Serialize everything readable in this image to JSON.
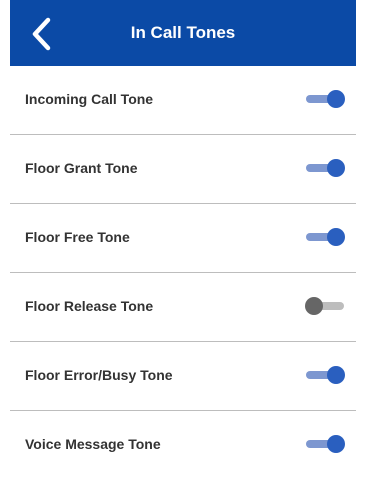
{
  "colors": {
    "header_bg": "#0b4aa6",
    "toggle_on_thumb": "#2a5fbf",
    "toggle_on_track": "#7d97d0",
    "toggle_off_thumb": "#666666",
    "toggle_off_track": "#bdbdbd"
  },
  "header": {
    "title": "In Call Tones",
    "back_icon": "chevron-left-icon"
  },
  "settings": [
    {
      "label": "Incoming Call Tone",
      "enabled": true
    },
    {
      "label": "Floor Grant Tone",
      "enabled": true
    },
    {
      "label": "Floor Free Tone",
      "enabled": true
    },
    {
      "label": "Floor Release Tone",
      "enabled": false
    },
    {
      "label": "Floor Error/Busy Tone",
      "enabled": true
    },
    {
      "label": "Voice Message Tone",
      "enabled": true
    }
  ]
}
